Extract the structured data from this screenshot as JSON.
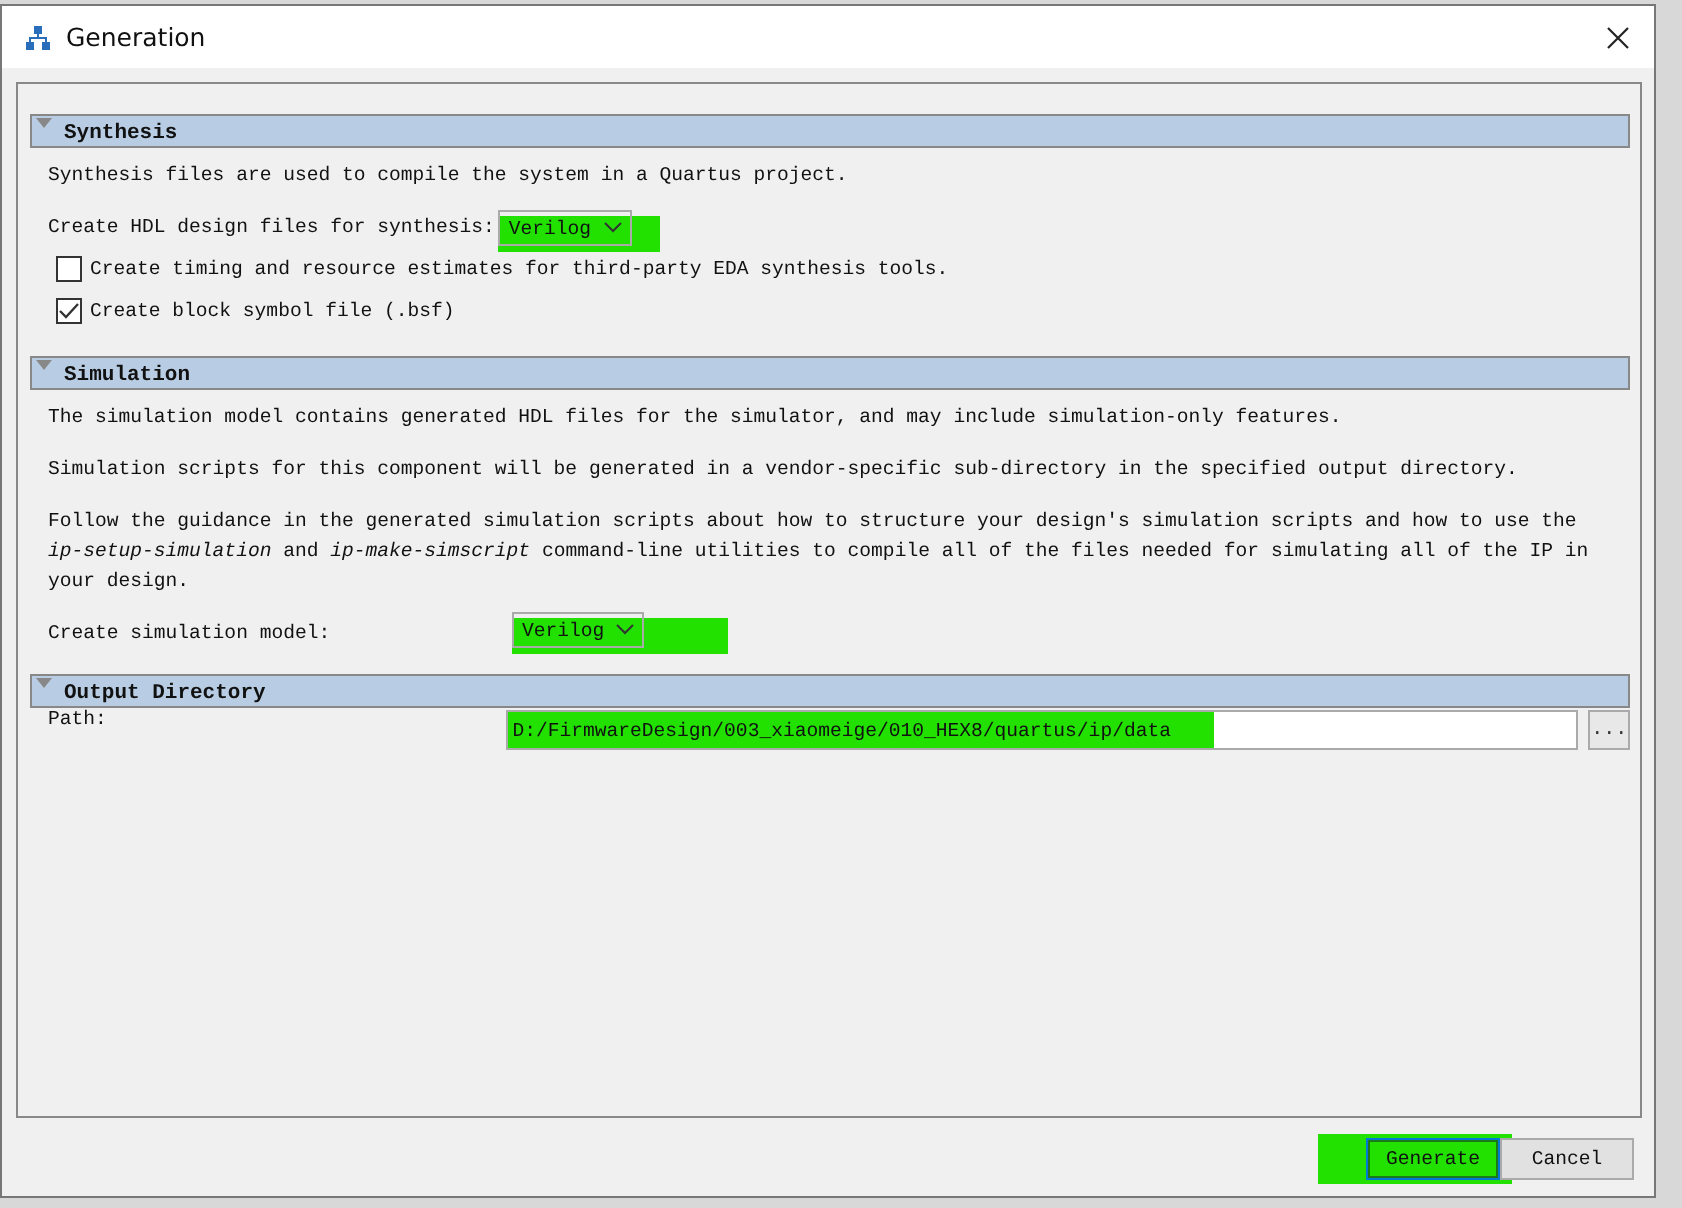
{
  "window": {
    "title": "Generation"
  },
  "sections": [
    {
      "title": "Synthesis",
      "expanded": true,
      "items": [
        {
          "kind": "text",
          "text": "Synthesis files are used to compile the system in a Quartus project."
        },
        {
          "kind": "select",
          "label": "Create HDL design files for synthesis:",
          "value": "Verilog"
        },
        {
          "kind": "checkbox",
          "label": "Create timing and resource estimates for third-party EDA synthesis tools.",
          "checked": false
        },
        {
          "kind": "checkbox",
          "label": "Create block symbol file (.bsf)",
          "checked": true
        }
      ]
    },
    {
      "title": "Simulation",
      "expanded": true,
      "items": [
        {
          "kind": "text",
          "text": "The simulation model contains generated HDL files for the simulator, and may include simulation-only features."
        },
        {
          "kind": "text",
          "text": "Simulation scripts for this component will be generated in a vendor-specific sub-directory in the specified output directory."
        },
        {
          "kind": "text",
          "text": "Follow the guidance in the generated simulation scripts about how to structure your design's simulation scripts and how to use the *ip-setup-simulation* and *ip-make-simscript* command-line utilities to compile all of the files needed for simulating all of the IP in your design."
        },
        {
          "kind": "select",
          "label": "Create simulation model:",
          "value": "Verilog"
        }
      ]
    },
    {
      "title": "Output Directory",
      "expanded": true,
      "items": [
        {
          "kind": "path",
          "label": "Path:",
          "value": "D:/FirmwareDesign/003_xiaomeige/010_HEX8/quartus/ip/data",
          "browse": "..."
        }
      ]
    }
  ],
  "buttons": [
    {
      "label": "Generate",
      "default": true
    },
    {
      "label": "Cancel",
      "default": false
    }
  ]
}
